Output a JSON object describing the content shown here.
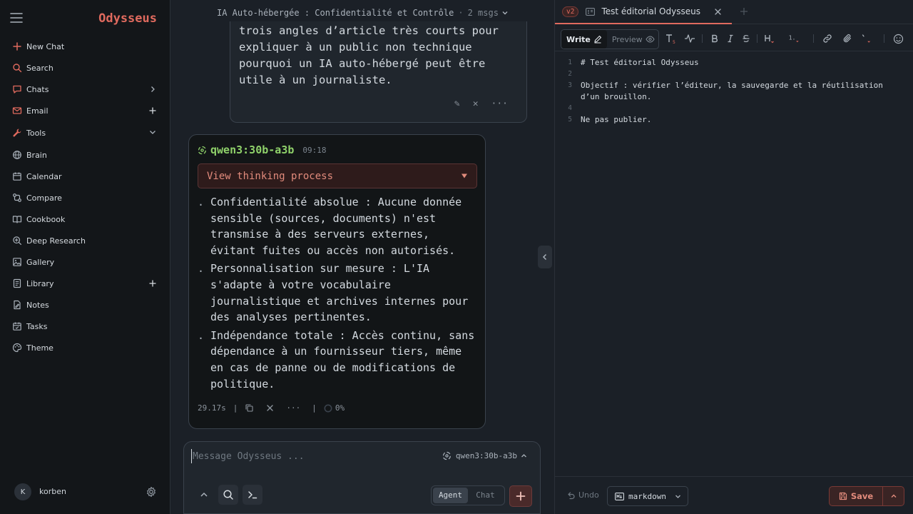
{
  "sidebar": {
    "brand": "Odysseus",
    "items": [
      {
        "label": "New Chat"
      },
      {
        "label": "Search"
      },
      {
        "label": "Chats"
      },
      {
        "label": "Email"
      },
      {
        "label": "Tools"
      },
      {
        "label": "Brain"
      },
      {
        "label": "Calendar"
      },
      {
        "label": "Compare"
      },
      {
        "label": "Cookbook"
      },
      {
        "label": "Deep Research"
      },
      {
        "label": "Gallery"
      },
      {
        "label": "Library"
      },
      {
        "label": "Notes"
      },
      {
        "label": "Tasks"
      },
      {
        "label": "Theme"
      }
    ],
    "user": {
      "initial": "K",
      "name": "korben"
    }
  },
  "chat": {
    "title": "IA Auto-hébergée : Confidentialité et Contrôle",
    "separator": "·",
    "msg_count": "2 msgs",
    "user_message": "trois angles d’article très courts pour expliquer à un public non technique pourquoi un IA auto-hébergé peut être utile à un journaliste.",
    "user_actions": {
      "edit": "✎",
      "delete": "✕",
      "more": "···"
    },
    "assistant": {
      "model": "qwen3:30b-a3b",
      "time": "09:18",
      "thinking_label": "View thinking process",
      "thinking_arrow": "▼",
      "points": [
        "Confidentialité absolue : Aucune donnée sensible (sources, documents) n'est transmise à des serveurs externes, évitant fuites ou accès non autorisés.",
        "Personnalisation sur mesure : L'IA s'adapte à votre vocabulaire journalistique et archives internes pour des analyses pertinentes.",
        "Indépendance totale : Accès continu, sans dépendance à un fournisseur tiers, même en cas de panne ou de modifications de politique."
      ],
      "duration": "29.17s",
      "pipe": "|",
      "more": "···",
      "context_pct": "0%"
    },
    "composer": {
      "placeholder": "Message Odysseus ...",
      "model": "qwen3:30b-a3b",
      "modes": [
        "Agent",
        "Chat"
      ],
      "active_mode": "Agent",
      "send": "+"
    }
  },
  "editor": {
    "version": "v2",
    "tab_name": "Test éditorial Odysseus",
    "modes": {
      "write": "Write",
      "preview": "Preview"
    },
    "lines": [
      {
        "n": "1",
        "text": "# Test éditorial Odysseus"
      },
      {
        "n": "2",
        "text": ""
      },
      {
        "n": "3",
        "text": "Objectif : vérifier l’éditeur, la sauvegarde et la réutilisation d’un brouillon."
      },
      {
        "n": "4",
        "text": ""
      },
      {
        "n": "5",
        "text": "Ne pas publier."
      }
    ],
    "footer": {
      "undo": "Undo",
      "language": "markdown",
      "save": "Save"
    },
    "colors": {
      "accent": "#e06a5e",
      "model_green": "#8fd16a"
    }
  }
}
